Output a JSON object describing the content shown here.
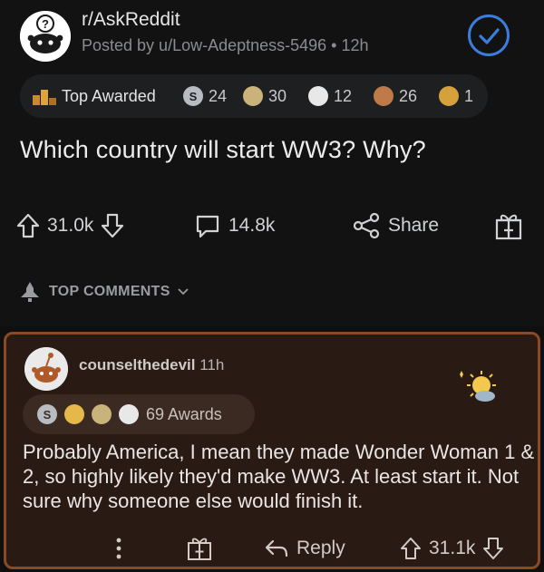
{
  "post": {
    "subreddit": "r/AskReddit",
    "posted_by": "Posted by u/Low-Adeptness-5496 • 12h",
    "title": "Which country will start WW3? Why?",
    "awards": {
      "label": "Top Awarded",
      "items": [
        {
          "icon": "silver-award-icon",
          "count": "24",
          "color": "#b8bcc2"
        },
        {
          "icon": "hands-award-icon",
          "count": "30",
          "color": "#c9b37a"
        },
        {
          "icon": "wholesome-award-icon",
          "count": "12",
          "color": "#e8e8e8"
        },
        {
          "icon": "helpful-award-icon",
          "count": "26",
          "color": "#c07a4a"
        },
        {
          "icon": "doge-award-icon",
          "count": "1",
          "color": "#d4a13c"
        }
      ]
    },
    "actions": {
      "upvotes": "31.0k",
      "comments": "14.8k",
      "share_label": "Share"
    }
  },
  "top_comments_label": "TOP COMMENTS",
  "comment": {
    "username": "counselthedevil",
    "age": "11h",
    "awards_label": "69 Awards",
    "body": "Probably America, I mean they made Wonder Woman 1 & 2, so highly likely they'd make WW3. At least start it. Not sure why someone else would finish it.",
    "reply_label": "Reply",
    "votes": "31.1k"
  },
  "colors": {
    "accent_blue": "#3b7ddd",
    "comment_border": "#8a4a26",
    "comment_bg": "#2a1a14"
  }
}
